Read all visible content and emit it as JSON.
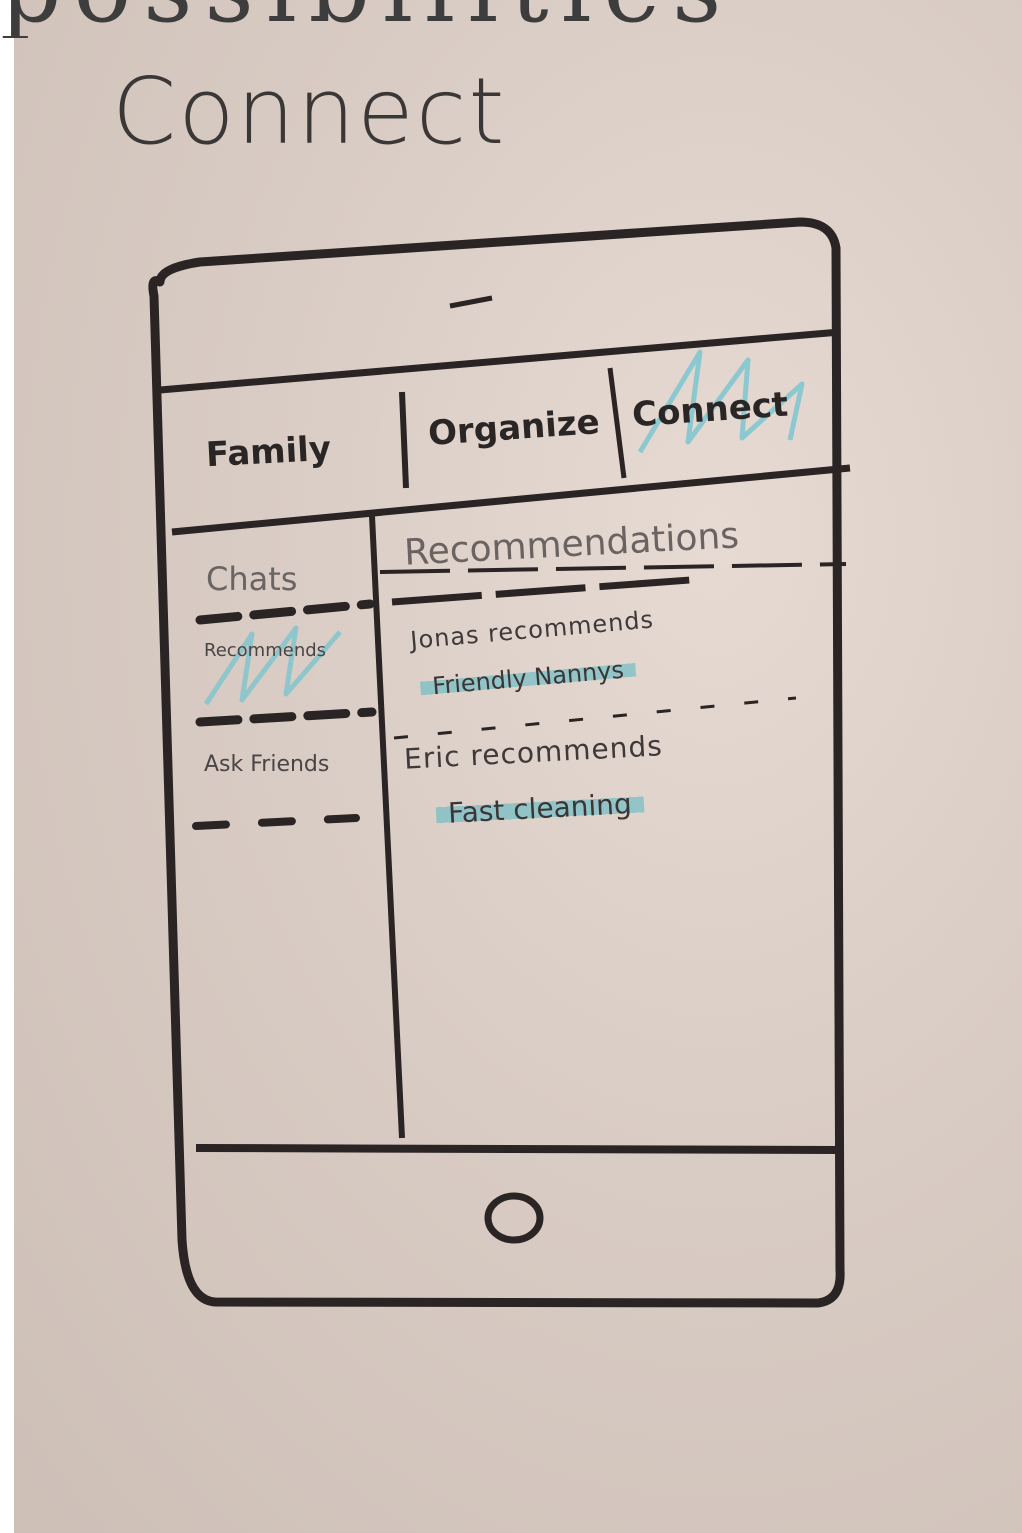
{
  "page": {
    "heading_partial": "possibilities",
    "title": "Connect"
  },
  "phone": {
    "top_bar_mark": "–",
    "home_button_icon": "home-button-icon"
  },
  "tabs": [
    {
      "label": "Family"
    },
    {
      "label": "Organize"
    },
    {
      "label": "Connect",
      "active": true
    }
  ],
  "sidebar": {
    "items": [
      {
        "label": "Chats"
      },
      {
        "label": "Recommends",
        "active": true
      },
      {
        "label": "Ask Friends"
      }
    ]
  },
  "main": {
    "title": "Recommendations",
    "recommendations": [
      {
        "line": "Jonas recommends",
        "item": "Friendly Nannys"
      },
      {
        "line": "Eric recommends",
        "item": "Fast cleaning"
      }
    ]
  },
  "colors": {
    "highlight": "#52b7c4",
    "ink": "#2f2a29",
    "paper": "#d8cbc3"
  }
}
